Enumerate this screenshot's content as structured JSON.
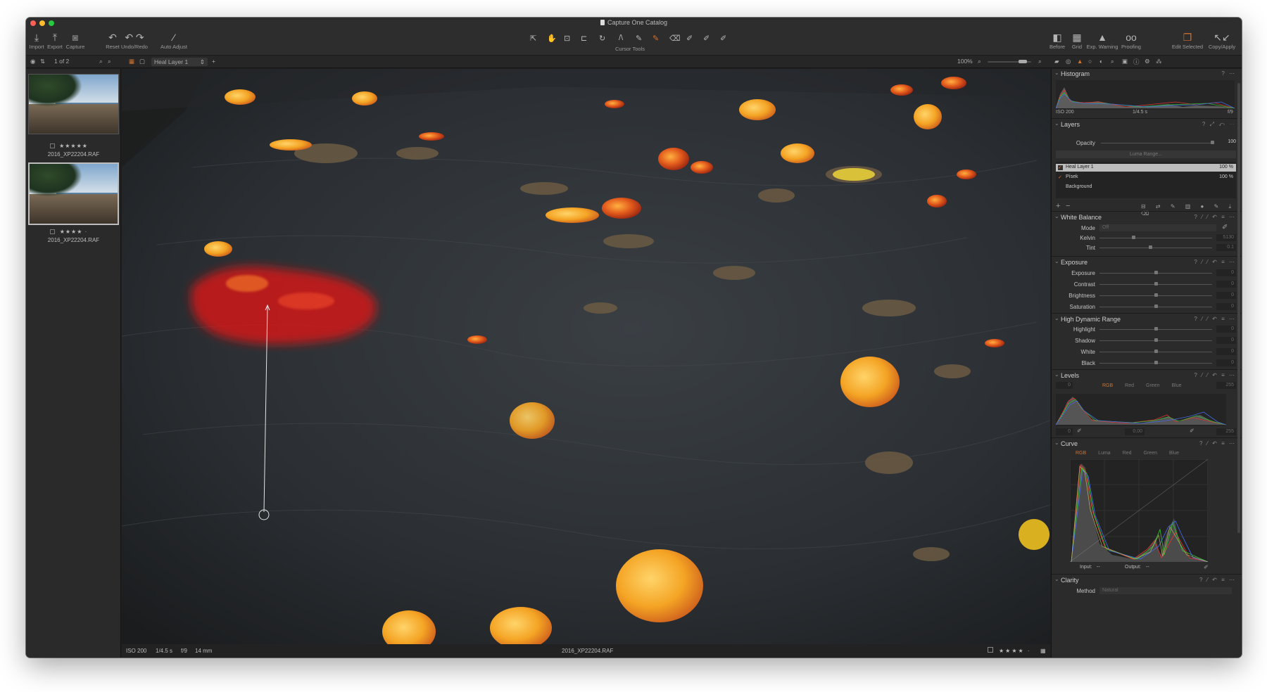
{
  "window": {
    "title": "Capture One Catalog"
  },
  "toolbar": {
    "import": "Import",
    "export": "Export",
    "capture": "Capture",
    "reset": "Reset",
    "undo_redo": "Undo/Redo",
    "auto_adjust": "Auto Adjust",
    "cursor_tools": "Cursor Tools",
    "before": "Before",
    "grid": "Grid",
    "exp_warning": "Exp. Warning",
    "proofing": "Proofing",
    "edit_selected": "Edit Selected",
    "copy_apply": "Copy/Apply"
  },
  "subbar": {
    "count": "1 of 2",
    "layer_select": "Heal Layer 1",
    "zoom": "100%"
  },
  "browser": {
    "items": [
      {
        "rating": "★★★★★",
        "name": "2016_XP22204.RAF"
      },
      {
        "rating": "★★★★ ·",
        "name": "2016_XP22204.RAF"
      }
    ]
  },
  "infobar": {
    "iso": "ISO 200",
    "shutter": "1/4.5 s",
    "aperture": "f/9",
    "focal": "14 mm",
    "filename": "2016_XP22204.RAF",
    "rating": "★★★★ ·"
  },
  "histogram": {
    "title": "Histogram",
    "iso": "ISO 200",
    "shutter": "1/4.5 s",
    "aperture": "f/9"
  },
  "layers": {
    "title": "Layers",
    "opacity_label": "Opacity",
    "opacity_value": "100",
    "luma_range": "Luma Range...",
    "items": [
      {
        "name": "Heal Layer 1",
        "value": "100 %"
      },
      {
        "name": "Písek",
        "value": "100 %"
      },
      {
        "name": "Background",
        "value": ""
      }
    ]
  },
  "white_balance": {
    "title": "White Balance",
    "mode_label": "Mode",
    "mode_value": "Off",
    "kelvin_label": "Kelvin",
    "kelvin_value": "5130",
    "tint_label": "Tint",
    "tint_value": "0.1"
  },
  "exposure": {
    "title": "Exposure",
    "rows": [
      {
        "label": "Exposure",
        "value": "0"
      },
      {
        "label": "Contrast",
        "value": "0"
      },
      {
        "label": "Brightness",
        "value": "0"
      },
      {
        "label": "Saturation",
        "value": "0"
      }
    ]
  },
  "hdr": {
    "title": "High Dynamic Range",
    "rows": [
      {
        "label": "Highlight",
        "value": "0"
      },
      {
        "label": "Shadow",
        "value": "0"
      },
      {
        "label": "White",
        "value": "0"
      },
      {
        "label": "Black",
        "value": "0"
      }
    ]
  },
  "levels": {
    "title": "Levels",
    "tabs": [
      "RGB",
      "Red",
      "Green",
      "Blue"
    ],
    "low": "0",
    "high": "255",
    "mid": "0,00",
    "out_low": "0",
    "out_high": "255"
  },
  "curve": {
    "title": "Curve",
    "tabs": [
      "RGB",
      "Luma",
      "Red",
      "Green",
      "Blue"
    ],
    "input_label": "Input:",
    "input_value": "--",
    "output_label": "Output:",
    "output_value": "--"
  },
  "clarity": {
    "title": "Clarity",
    "method_label": "Method",
    "method_value": "Natural"
  },
  "colors": {
    "accent": "#d4722c",
    "panel": "#2b2b2b",
    "heal_mask": "#e01414"
  }
}
